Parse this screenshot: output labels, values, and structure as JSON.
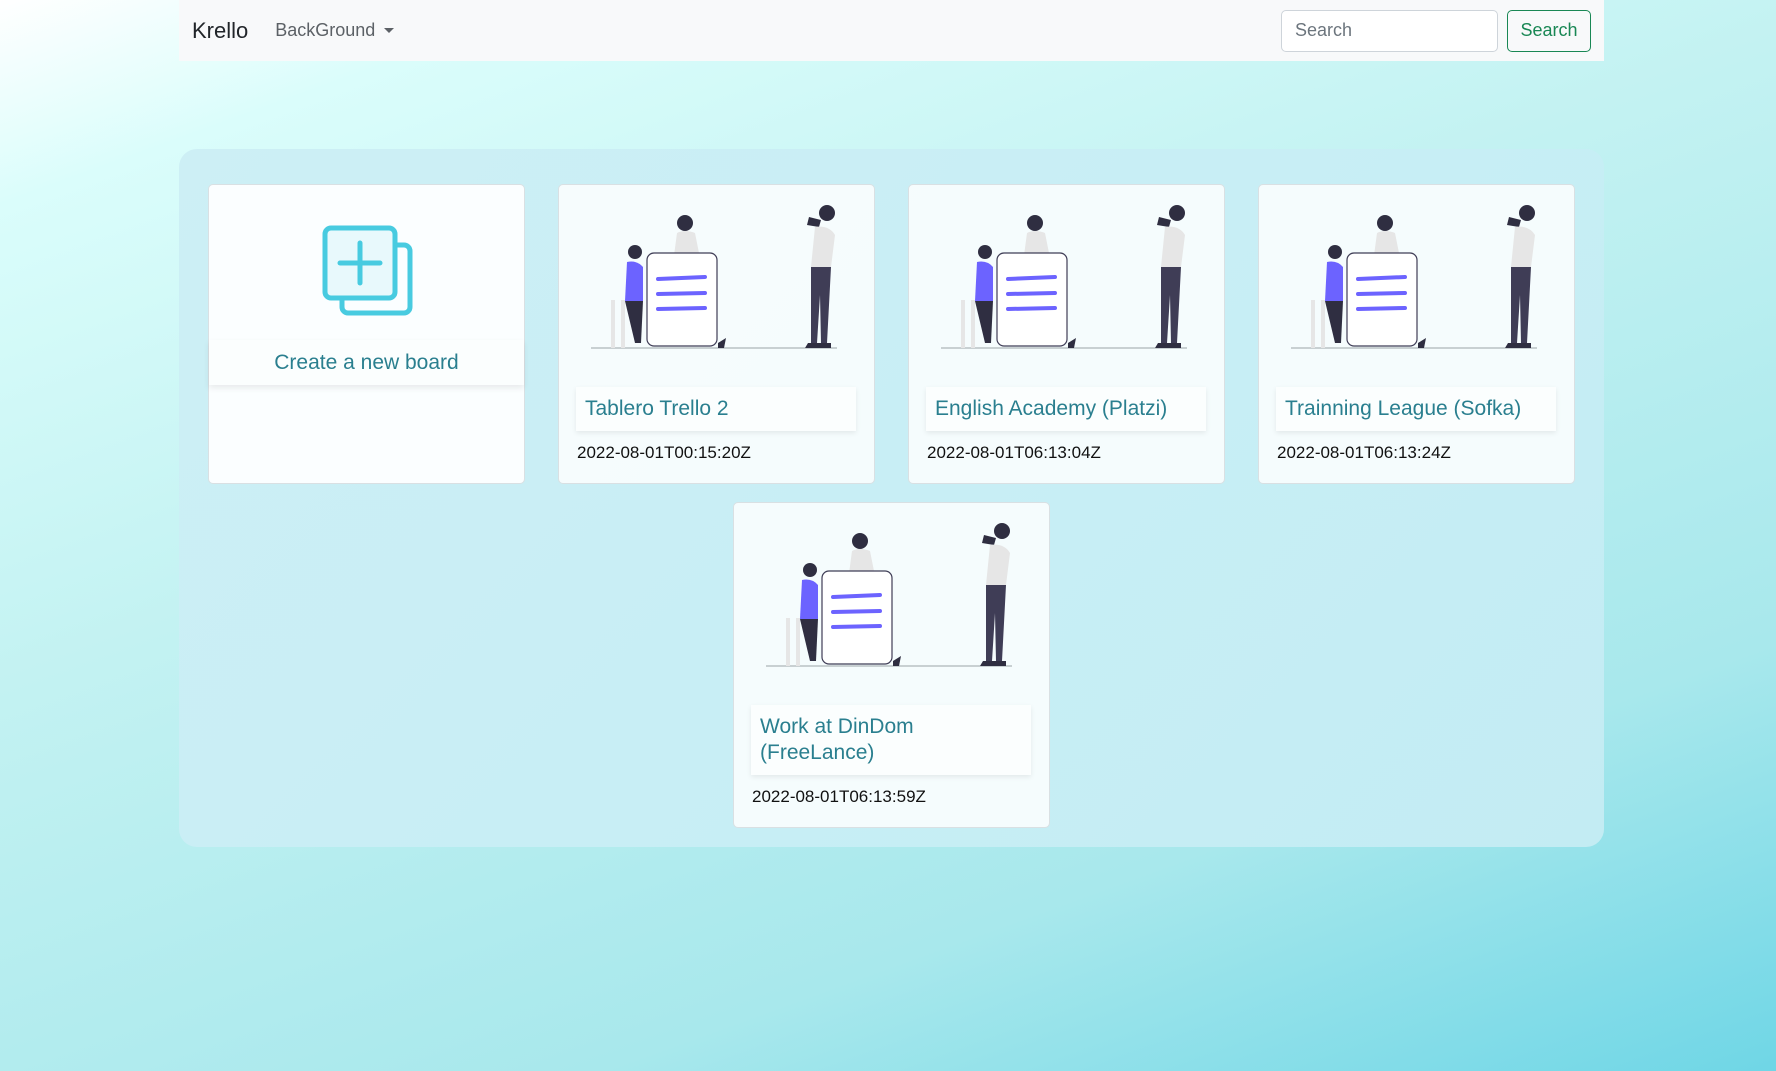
{
  "navbar": {
    "brand": "Krello",
    "dropdown_label": "BackGround",
    "search_placeholder": "Search",
    "search_button": "Search"
  },
  "create_card": {
    "label": "Create a new board",
    "icon": "add-board-icon"
  },
  "boards": [
    {
      "title": "Tablero Trello 2",
      "date": "2022-08-01T00:15:20Z"
    },
    {
      "title": "English Academy (Platzi)",
      "date": "2022-08-01T06:13:04Z"
    },
    {
      "title": "Trainning League (Sofka)",
      "date": "2022-08-01T06:13:24Z"
    },
    {
      "title": "Work at DinDom (FreeLance)",
      "date": "2022-08-01T06:13:59Z"
    }
  ],
  "colors": {
    "accent": "#2a7f8f",
    "success": "#198754",
    "icon": "#48cbe0",
    "illustration_purple": "#6c63ff"
  }
}
